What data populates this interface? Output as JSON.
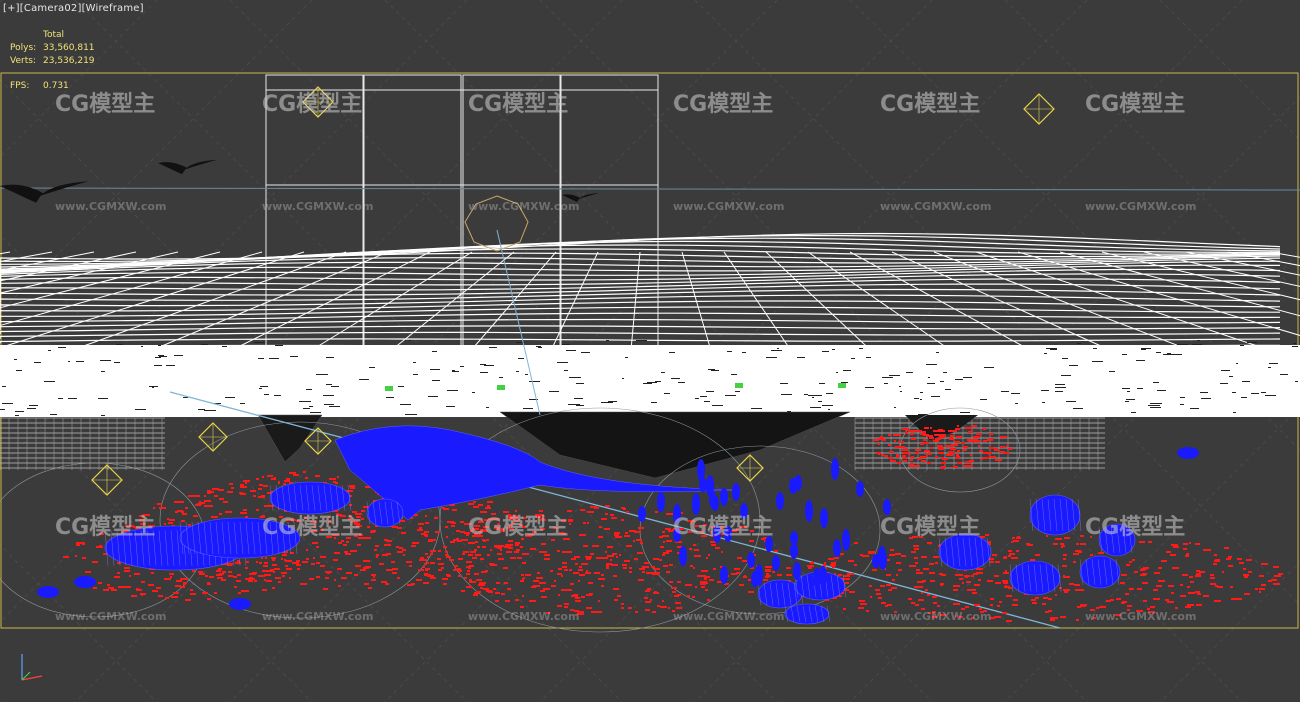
{
  "viewport": {
    "label_plus": "[+]",
    "label_camera": "[Camera02]",
    "label_mode": "[Wireframe]"
  },
  "stats": {
    "header": "Total",
    "polys_label": "Polys:",
    "polys_value": "33,560,811",
    "verts_label": "Verts:",
    "verts_value": "23,536,219",
    "fps_label": "FPS:",
    "fps_value": "0.731"
  },
  "watermark": {
    "logo_text": "CG模型主",
    "url_text": "www.CGMXW.com"
  },
  "colors": {
    "background": "#3b3b3b",
    "safe_frame": "#c8b84a",
    "wire_white": "#ffffff",
    "fish_blue": "#1a1aff",
    "particles_red": "#ff1a1a",
    "helper_yellow": "#e8d44a",
    "camera_line": "#7fb6d6"
  }
}
